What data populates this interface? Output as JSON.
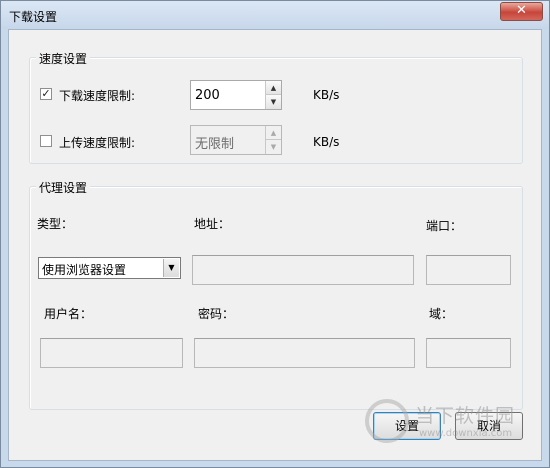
{
  "window": {
    "title": "下载设置",
    "close_label": "✕"
  },
  "speed_group": {
    "title": "速度设置",
    "download": {
      "checked": true,
      "check_mark": "✓",
      "label": "下载速度限制:",
      "value": "200",
      "unit": "KB/s"
    },
    "upload": {
      "checked": false,
      "check_mark": "",
      "label": "上传速度限制:",
      "value": "无限制",
      "unit": "KB/s"
    }
  },
  "proxy_group": {
    "title": "代理设置",
    "type_label": "类型：",
    "type_value": "使用浏览器设置",
    "address_label": "地址：",
    "port_label": "端口：",
    "username_label": "用户名：",
    "password_label": "密码：",
    "domain_label": "域："
  },
  "buttons": {
    "ok": "设置",
    "cancel": "取消"
  },
  "watermark": {
    "text": "当下软件园",
    "url": "www.downxia.com"
  },
  "icons": {
    "spin_up": "▲",
    "spin_down": "▼",
    "dropdown": "▼"
  }
}
